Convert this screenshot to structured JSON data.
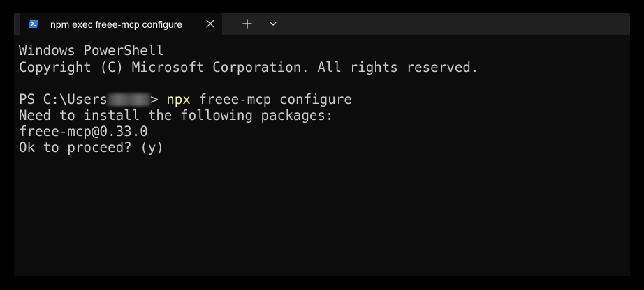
{
  "window": {
    "tab": {
      "title": "npm exec freee-mcp configure",
      "icon": "powershell-icon"
    },
    "new_tab_glyph": "+",
    "dropdown_icon": "chevron-down-icon",
    "close_icon": "close-icon",
    "colors": {
      "background": "#0c0c0c",
      "tabbar": "#202020",
      "text": "#cccccc",
      "command": "#f9f1a5",
      "icon_blue": "#2f7bd8"
    }
  },
  "terminal": {
    "banner": "Windows PowerShell",
    "copyright": "Copyright (C) Microsoft Corporation. All rights reserved.",
    "prompt_prefix": "PS C:\\Users",
    "prompt_suffix": "> ",
    "command_exe": "npx",
    "command_args": " freee-mcp configure",
    "output": [
      "Need to install the following packages:",
      "freee-mcp@0.33.0",
      "Ok to proceed? (y)"
    ]
  }
}
